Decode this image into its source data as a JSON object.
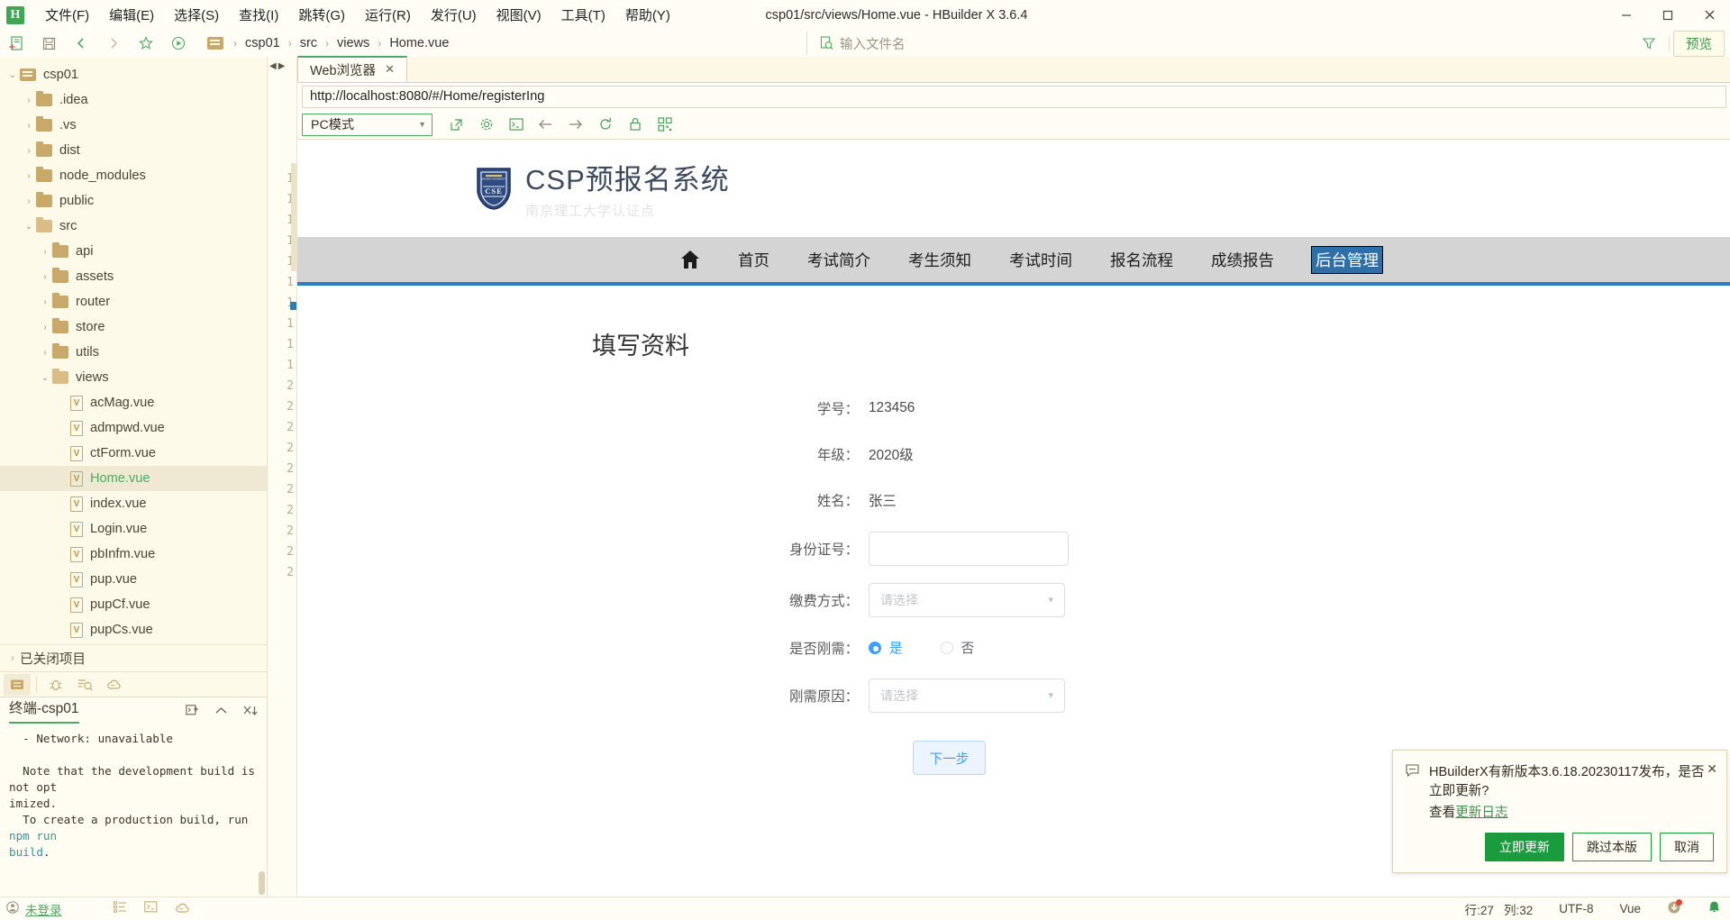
{
  "titlebar": {
    "logo": "H",
    "title": "csp01/src/views/Home.vue - HBuilder X 3.6.4",
    "menus": [
      {
        "label": "文件(F)",
        "name": "menu-file"
      },
      {
        "label": "编辑(E)",
        "name": "menu-edit"
      },
      {
        "label": "选择(S)",
        "name": "menu-select"
      },
      {
        "label": "查找(I)",
        "name": "menu-find"
      },
      {
        "label": "跳转(G)",
        "name": "menu-goto"
      },
      {
        "label": "运行(R)",
        "name": "menu-run"
      },
      {
        "label": "发行(U)",
        "name": "menu-publish"
      },
      {
        "label": "视图(V)",
        "name": "menu-view"
      },
      {
        "label": "工具(T)",
        "name": "menu-tools"
      },
      {
        "label": "帮助(Y)",
        "name": "menu-help"
      }
    ],
    "window_buttons": {
      "minimize": "—",
      "maximize": "❐",
      "close": "✕"
    }
  },
  "toolbar": {
    "breadcrumb": [
      "csp01",
      "src",
      "views",
      "Home.vue"
    ],
    "filename_placeholder": "输入文件名",
    "preview_label": "预览",
    "icons": [
      "new-file-icon",
      "save-icon",
      "back-icon",
      "forward-icon",
      "favorite-icon",
      "run-icon"
    ]
  },
  "sidebar": {
    "tree": [
      {
        "label": "csp01",
        "depth": 0,
        "icon": "project-folder-icon",
        "twisty": "⌄",
        "selected": false
      },
      {
        "label": ".idea",
        "depth": 1,
        "icon": "folder-closed-icon",
        "twisty": "›",
        "selected": false
      },
      {
        "label": ".vs",
        "depth": 1,
        "icon": "folder-closed-icon",
        "twisty": "›",
        "selected": false
      },
      {
        "label": "dist",
        "depth": 1,
        "icon": "folder-closed-icon",
        "twisty": "›",
        "selected": false
      },
      {
        "label": "node_modules",
        "depth": 1,
        "icon": "folder-closed-icon",
        "twisty": "›",
        "selected": false
      },
      {
        "label": "public",
        "depth": 1,
        "icon": "folder-closed-icon",
        "twisty": "›",
        "selected": false
      },
      {
        "label": "src",
        "depth": 1,
        "icon": "folder-open-icon",
        "twisty": "⌄",
        "selected": false
      },
      {
        "label": "api",
        "depth": 2,
        "icon": "folder-closed-icon",
        "twisty": "›",
        "selected": false
      },
      {
        "label": "assets",
        "depth": 2,
        "icon": "folder-closed-icon",
        "twisty": "›",
        "selected": false
      },
      {
        "label": "router",
        "depth": 2,
        "icon": "folder-closed-icon",
        "twisty": "›",
        "selected": false
      },
      {
        "label": "store",
        "depth": 2,
        "icon": "folder-closed-icon",
        "twisty": "›",
        "selected": false
      },
      {
        "label": "utils",
        "depth": 2,
        "icon": "folder-closed-icon",
        "twisty": "›",
        "selected": false
      },
      {
        "label": "views",
        "depth": 2,
        "icon": "folder-open-icon",
        "twisty": "⌄",
        "selected": false
      },
      {
        "label": "acMag.vue",
        "depth": 3,
        "icon": "vue-file-icon",
        "twisty": "",
        "selected": false
      },
      {
        "label": "admpwd.vue",
        "depth": 3,
        "icon": "vue-file-icon",
        "twisty": "",
        "selected": false
      },
      {
        "label": "ctForm.vue",
        "depth": 3,
        "icon": "vue-file-icon",
        "twisty": "",
        "selected": false
      },
      {
        "label": "Home.vue",
        "depth": 3,
        "icon": "vue-file-icon",
        "twisty": "",
        "selected": true
      },
      {
        "label": "index.vue",
        "depth": 3,
        "icon": "vue-file-icon",
        "twisty": "",
        "selected": false
      },
      {
        "label": "Login.vue",
        "depth": 3,
        "icon": "vue-file-icon",
        "twisty": "",
        "selected": false
      },
      {
        "label": "pbInfm.vue",
        "depth": 3,
        "icon": "vue-file-icon",
        "twisty": "",
        "selected": false
      },
      {
        "label": "pup.vue",
        "depth": 3,
        "icon": "vue-file-icon",
        "twisty": "",
        "selected": false
      },
      {
        "label": "pupCf.vue",
        "depth": 3,
        "icon": "vue-file-icon",
        "twisty": "",
        "selected": false
      },
      {
        "label": "pupCs.vue",
        "depth": 3,
        "icon": "vue-file-icon",
        "twisty": "",
        "selected": false
      }
    ],
    "closed_projects": "已关闭项目",
    "closed_projects_twisty": "›"
  },
  "terminal": {
    "title": "终端-csp01",
    "lines_pre": "  - Network: unavailable\n\n  Note that the development build is not opt\nimized.\n  To create a production build, run ",
    "cmd": "npm run\nbuild",
    "lines_post": "."
  },
  "gutter": {
    "lines": [
      "1",
      "1",
      "1",
      "1",
      "1",
      "1",
      "1",
      "1",
      "1",
      "1",
      "2",
      "2",
      "2",
      "2",
      "2",
      "2",
      "2",
      "2",
      "2",
      "2"
    ]
  },
  "browser": {
    "tab_label": "Web浏览器",
    "tab_close": "✕",
    "url": "http://localhost:8080/#/Home/registerIng",
    "mode": "PC模式",
    "tool_icons": [
      "open-external-icon",
      "settings-icon",
      "console-icon",
      "back-icon",
      "forward-icon",
      "reload-icon",
      "lock-icon",
      "qrcode-icon"
    ]
  },
  "page": {
    "site_title": "CSP预报名系统",
    "site_subtitle": "南京理工大学认证点",
    "crest_text": "CSE",
    "nav": {
      "home_icon": "home-icon",
      "items": [
        {
          "label": "首页",
          "selected": false
        },
        {
          "label": "考试简介",
          "selected": false
        },
        {
          "label": "考生须知",
          "selected": false
        },
        {
          "label": "考试时间",
          "selected": false
        },
        {
          "label": "报名流程",
          "selected": false
        },
        {
          "label": "成绩报告",
          "selected": false
        },
        {
          "label": "后台管理",
          "selected": true
        }
      ]
    },
    "heading": "填写资料",
    "form": {
      "student_id": {
        "label": "学号：",
        "value": "123456"
      },
      "grade": {
        "label": "年级：",
        "value": "2020级"
      },
      "name": {
        "label": "姓名：",
        "value": "张三"
      },
      "id_card": {
        "label": "身份证号：",
        "value": "",
        "placeholder": ""
      },
      "payment": {
        "label": "缴费方式：",
        "value": "请选择"
      },
      "is_needed": {
        "label": "是否刚需：",
        "options": [
          "是",
          "否"
        ],
        "selected": "是"
      },
      "reason": {
        "label": "刚需原因：",
        "value": "请选择"
      },
      "next_button": "下一步"
    }
  },
  "toast": {
    "icon": "message-icon",
    "message": "HBuilderX有新版本3.6.18.20230117发布，是否立即更新?",
    "link_prefix": "查看",
    "link_text": "更新日志",
    "close": "✕",
    "buttons": {
      "primary": "立即更新",
      "skip": "跳过本版",
      "cancel": "取消"
    }
  },
  "statusbar": {
    "user": "未登录",
    "line": "行:27",
    "column": "列:32",
    "encoding": "UTF-8",
    "language": "Vue"
  }
}
